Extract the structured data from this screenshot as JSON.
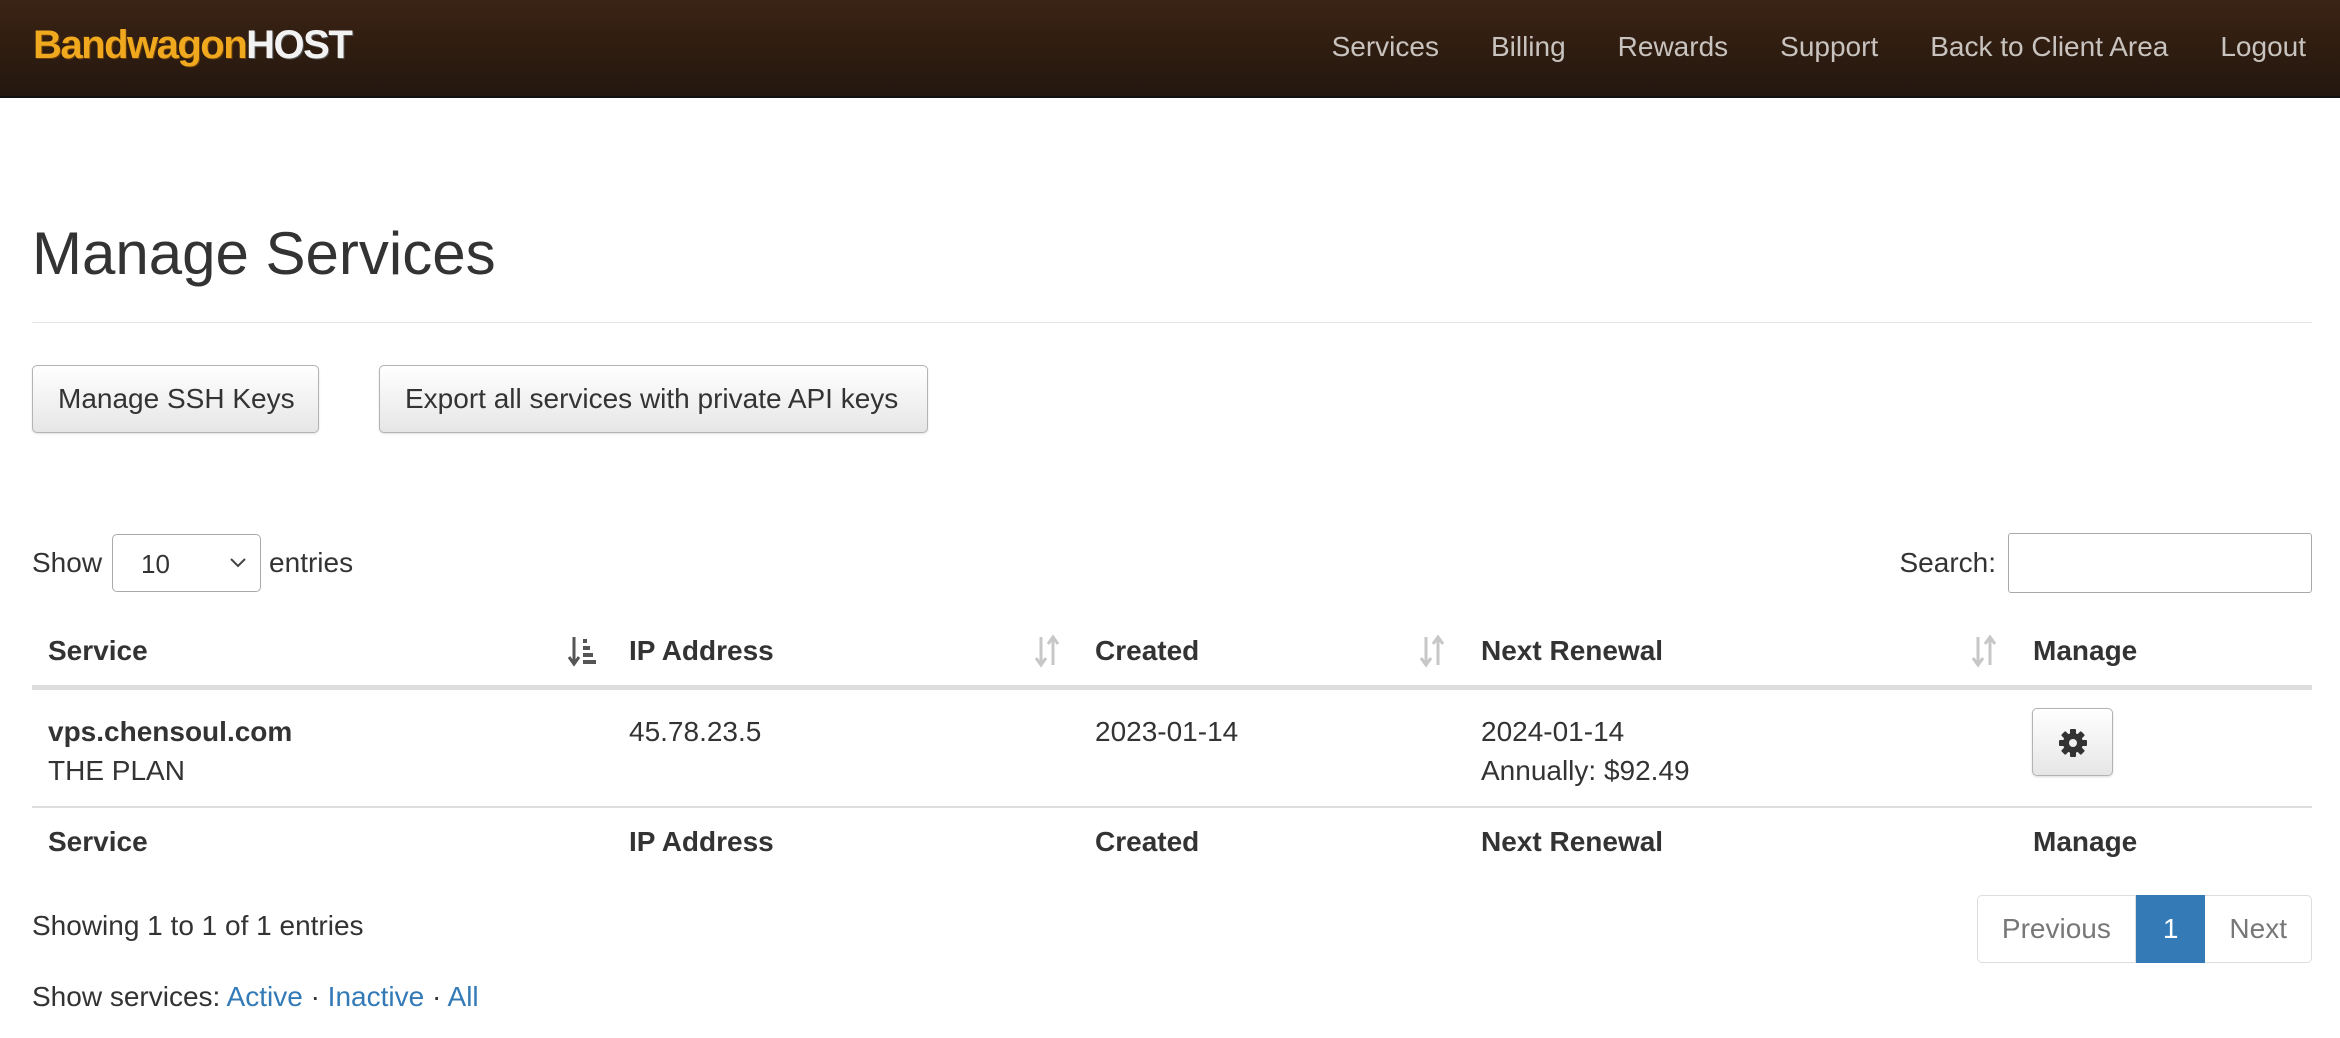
{
  "brand": {
    "part1": "Bandwagon",
    "part2": "HOST"
  },
  "nav": [
    "Services",
    "Billing",
    "Rewards",
    "Support",
    "Back to Client Area",
    "Logout"
  ],
  "page": {
    "title": "Manage Services"
  },
  "actions": {
    "ssh_keys": "Manage SSH Keys",
    "export": "Export all services with private API keys"
  },
  "length": {
    "show": "Show",
    "value": "10",
    "entries": "entries"
  },
  "search": {
    "label": "Search:",
    "value": ""
  },
  "table": {
    "columns": [
      "Service",
      "IP Address",
      "Created",
      "Next Renewal",
      "Manage"
    ],
    "rows": [
      {
        "service": "vps.chensoul.com",
        "plan": "THE PLAN",
        "ip": "45.78.23.5",
        "created": "2023-01-14",
        "renewal": "2024-01-14",
        "billing": "Annually: $92.49",
        "manage_icon": "gear-icon"
      }
    ]
  },
  "info": "Showing 1 to 1 of 1 entries",
  "pagination": {
    "previous": "Previous",
    "current": "1",
    "next": "Next"
  },
  "filter": {
    "label": "Show services:",
    "active": "Active",
    "inactive": "Inactive",
    "all": "All",
    "separator": "·"
  },
  "colors": {
    "navbar": "#2e1c10",
    "brand_orange": "#f0a91e",
    "link": "#337ab7",
    "active_page": "#337ab7"
  }
}
